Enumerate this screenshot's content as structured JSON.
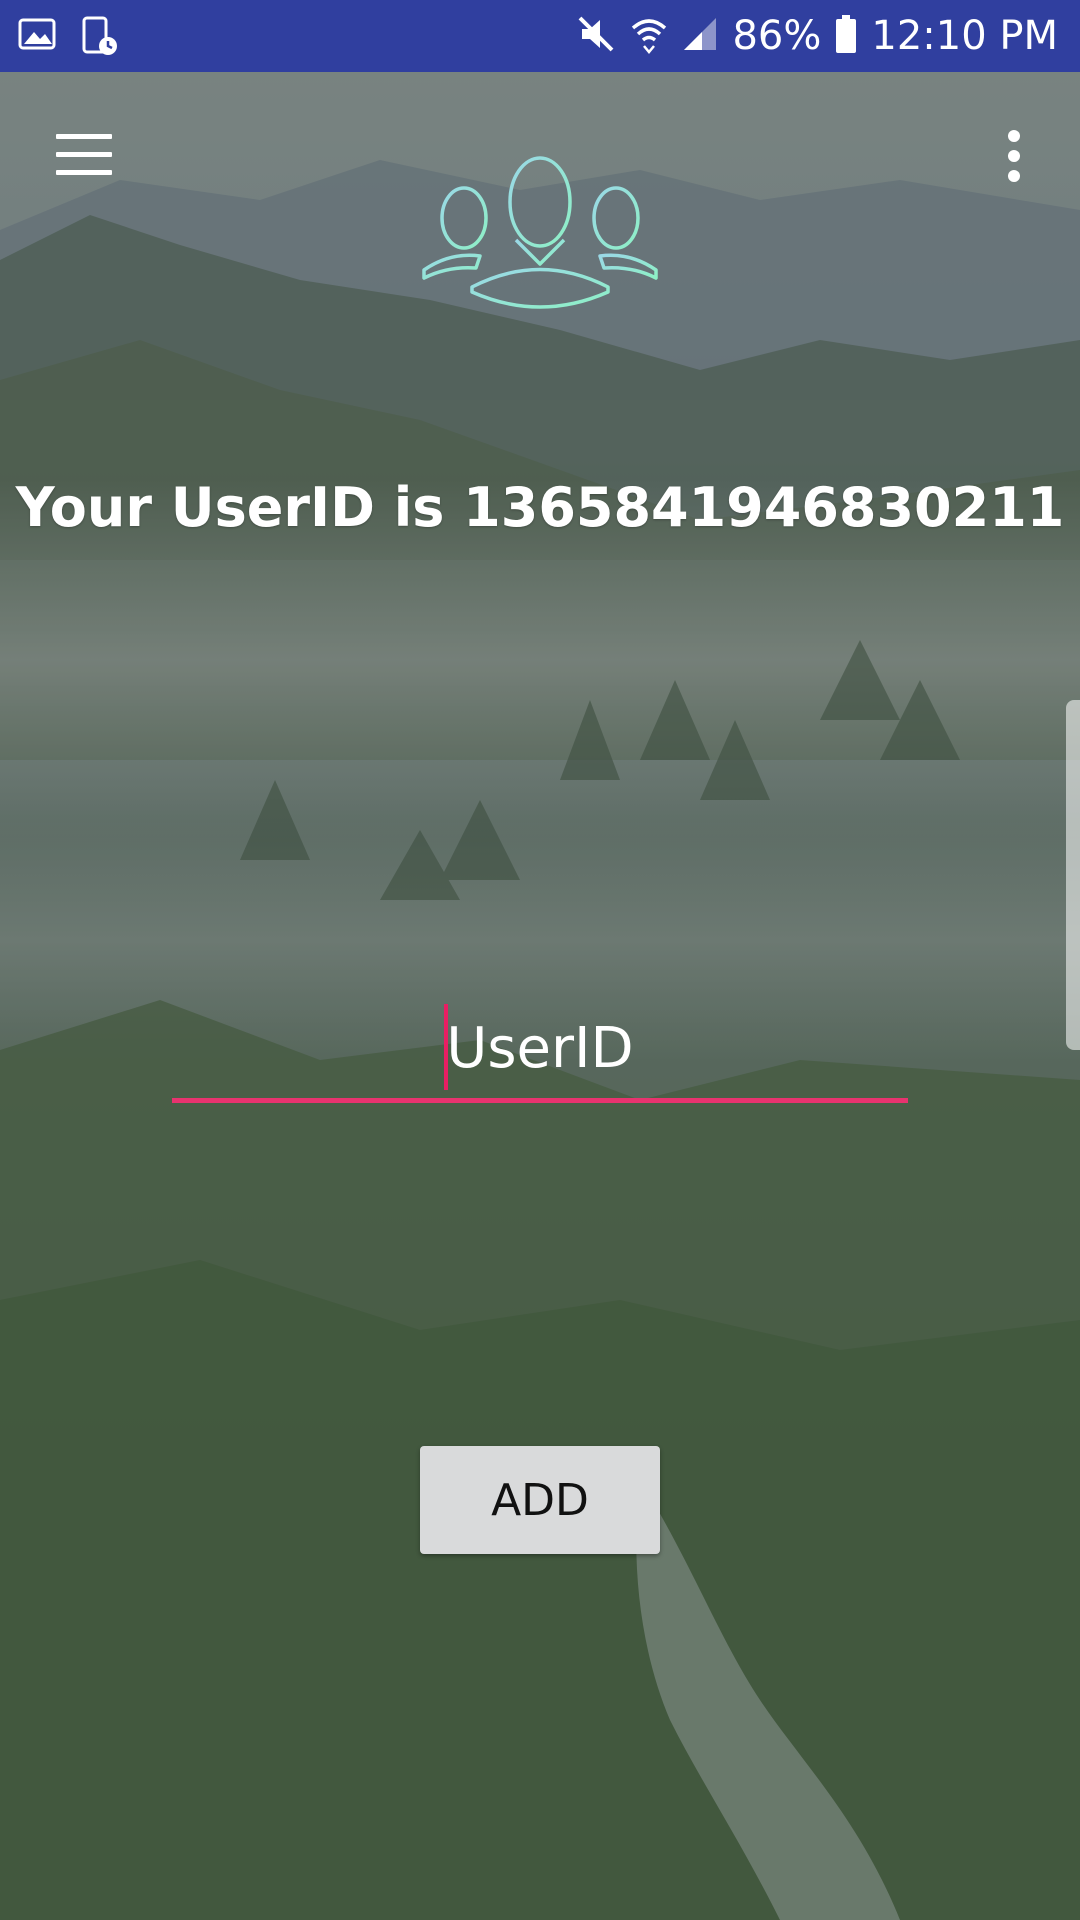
{
  "status_bar": {
    "icons_left": [
      "image-icon",
      "screenshot-schedule-icon"
    ],
    "icons_right": [
      "mute-icon",
      "wifi-icon",
      "signal-icon",
      "battery-icon"
    ],
    "battery": "86%",
    "time": "12:10 PM"
  },
  "toolbar": {
    "menu_icon": "hamburger-icon",
    "more_icon": "more-vert-icon",
    "logo_icon": "group-users-icon"
  },
  "main": {
    "userid_message": "Your UserID is 1365841946830211",
    "input_placeholder": "UserID",
    "input_value": "",
    "add_label": "ADD"
  },
  "colors": {
    "status_bar": "#303f9f",
    "accent": "#e91e63",
    "button_bg": "#d9dadb",
    "text": "#ffffff"
  }
}
